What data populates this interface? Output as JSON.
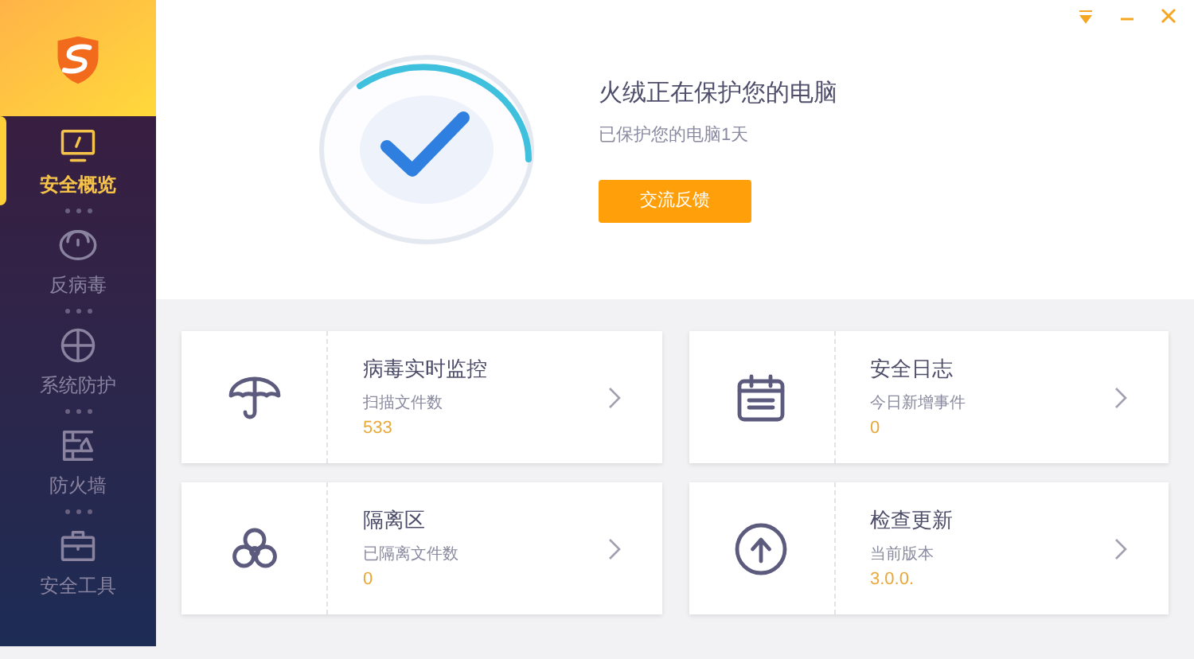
{
  "sidebar": {
    "items": [
      {
        "label": "安全概览",
        "selected": true
      },
      {
        "label": "反病毒",
        "selected": false
      },
      {
        "label": "系统防护",
        "selected": false
      },
      {
        "label": "防火墙",
        "selected": false
      },
      {
        "label": "安全工具",
        "selected": false
      }
    ]
  },
  "status": {
    "title": "火绒正在保护您的电脑",
    "subtitle": "已保护您的电脑1天",
    "button": "交流反馈"
  },
  "cards": [
    {
      "title": "病毒实时监控",
      "label": "扫描文件数",
      "value": "533"
    },
    {
      "title": "安全日志",
      "label": "今日新增事件",
      "value": "0"
    },
    {
      "title": "隔离区",
      "label": "已隔离文件数",
      "value": "0"
    },
    {
      "title": "检查更新",
      "label": "当前版本",
      "value": "3.0.0."
    }
  ]
}
